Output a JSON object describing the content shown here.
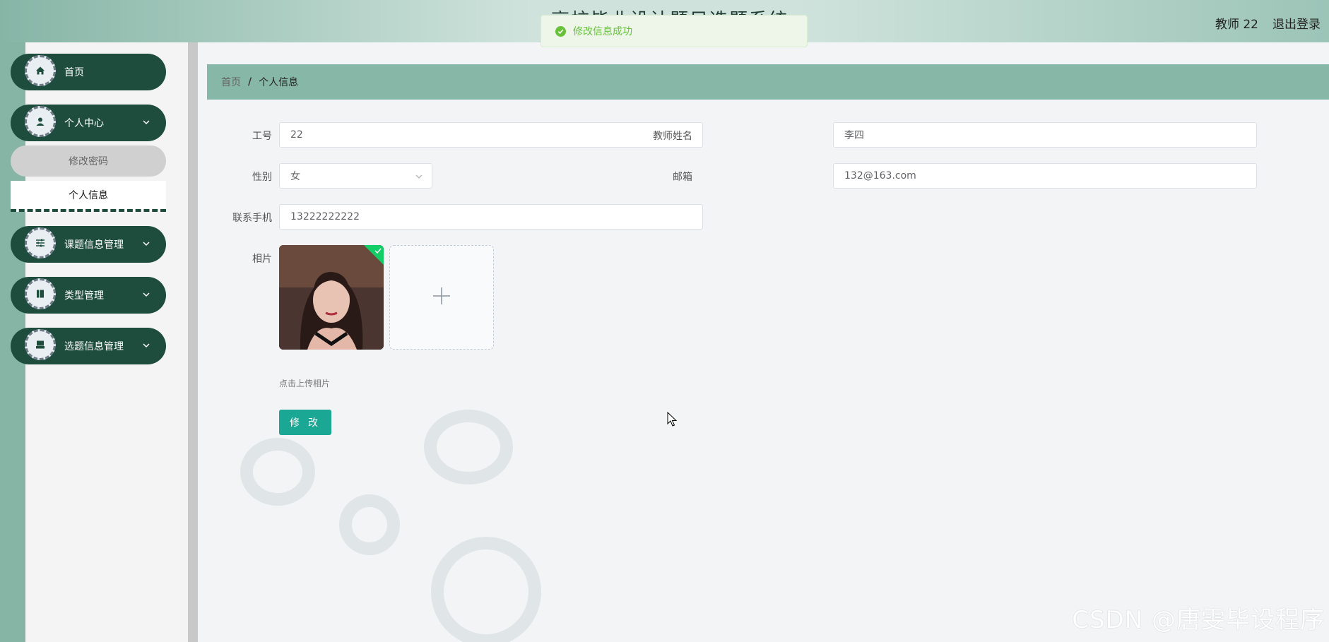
{
  "header": {
    "app_title": "高校毕业设计题目选题系统",
    "user_label": "教师 22",
    "logout_label": "退出登录"
  },
  "toast": {
    "message": "修改信息成功",
    "color": "#67c23a"
  },
  "sidebar": {
    "items": [
      {
        "label": "首页",
        "icon": "home-icon"
      },
      {
        "label": "个人中心",
        "icon": "user-icon",
        "expanded": true,
        "children": [
          {
            "label": "修改密码"
          },
          {
            "label": "个人信息",
            "active": true
          }
        ]
      },
      {
        "label": "课题信息管理",
        "icon": "sliders-icon"
      },
      {
        "label": "类型管理",
        "icon": "book-icon"
      },
      {
        "label": "选题信息管理",
        "icon": "inbox-icon"
      }
    ],
    "accent": "#1e4d3e"
  },
  "breadcrumb": {
    "home": "首页",
    "separator": "/",
    "current": "个人信息"
  },
  "form": {
    "work_id": {
      "label": "工号",
      "value": "22"
    },
    "teacher_name": {
      "label": "教师姓名",
      "value": "李四"
    },
    "gender": {
      "label": "性别",
      "value": "女"
    },
    "email": {
      "label": "邮箱",
      "value": "132@163.com"
    },
    "phone": {
      "label": "联系手机",
      "value": "13222222222"
    },
    "photo": {
      "label": "相片",
      "hint": "点击上传相片"
    },
    "submit_label": "修 改"
  },
  "watermark": "CSDN @唐雯毕设程序"
}
